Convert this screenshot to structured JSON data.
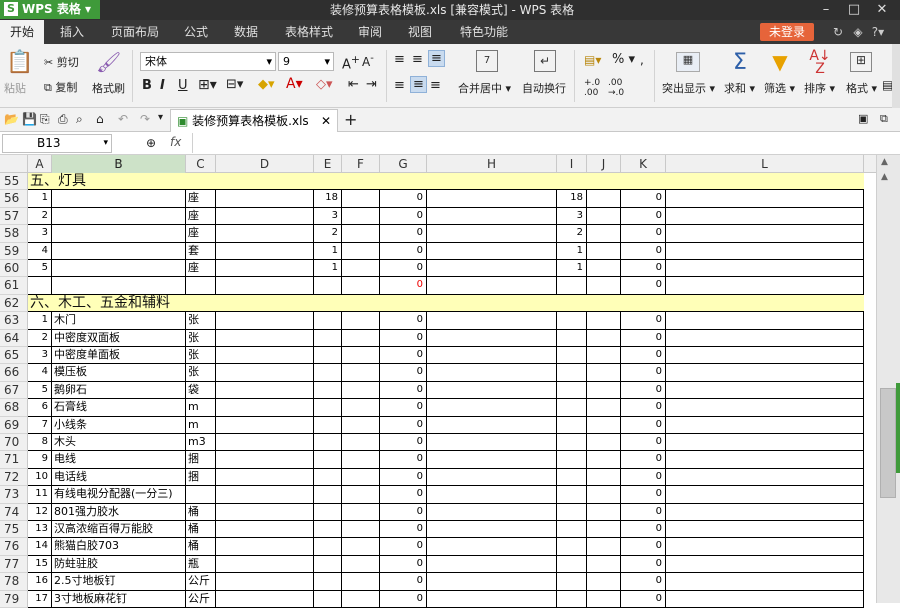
{
  "app": {
    "name": "WPS 表格",
    "window_title": "装修预算表格模板.xls [兼容模式] - WPS 表格"
  },
  "menus": [
    "开始",
    "插入",
    "页面布局",
    "公式",
    "数据",
    "表格样式",
    "审阅",
    "视图",
    "特色功能"
  ],
  "login": "未登录",
  "ribbon": {
    "paste": "粘贴",
    "cut": "剪切",
    "copy": "复制",
    "format_painter": "格式刷",
    "font_name": "宋体",
    "font_size": "9",
    "merge_center": "合并居中",
    "wrap_text": "自动换行",
    "percent": "%",
    "highlight": "突出显示",
    "sum": "求和",
    "filter": "筛选",
    "sort": "排序",
    "format": "格式"
  },
  "doc_tab": "装修预算表格模板.xls",
  "formula_bar": {
    "cell_ref": "B13",
    "fx": "fx",
    "value": ""
  },
  "columns": [
    "A",
    "B",
    "C",
    "D",
    "E",
    "F",
    "G",
    "H",
    "I",
    "J",
    "K",
    "L"
  ],
  "selected_column": "B",
  "rows": [
    {
      "n": "55",
      "type": "section",
      "title": "五、灯具"
    },
    {
      "n": "56",
      "a": "1",
      "b": "",
      "c": "座",
      "e": "18",
      "g": "0",
      "i": "18",
      "k": "0"
    },
    {
      "n": "57",
      "a": "2",
      "b": "",
      "c": "座",
      "e": "3",
      "g": "0",
      "i": "3",
      "k": "0"
    },
    {
      "n": "58",
      "a": "3",
      "b": "",
      "c": "座",
      "e": "2",
      "g": "0",
      "i": "2",
      "k": "0"
    },
    {
      "n": "59",
      "a": "4",
      "b": "",
      "c": "套",
      "e": "1",
      "g": "0",
      "i": "1",
      "k": "0"
    },
    {
      "n": "60",
      "a": "5",
      "b": "",
      "c": "座",
      "e": "1",
      "g": "0",
      "i": "1",
      "k": "0"
    },
    {
      "n": "61",
      "a": "",
      "b": "",
      "c": "",
      "e": "",
      "g": "0",
      "g_red": true,
      "i": "",
      "k": "0"
    },
    {
      "n": "62",
      "type": "section",
      "title": "六、木工、五金和辅料"
    },
    {
      "n": "63",
      "a": "1",
      "b": "木门",
      "c": "张",
      "e": "",
      "g": "0",
      "i": "",
      "k": "0"
    },
    {
      "n": "64",
      "a": "2",
      "b": "中密度双面板",
      "c": "张",
      "e": "",
      "g": "0",
      "i": "",
      "k": "0"
    },
    {
      "n": "65",
      "a": "3",
      "b": "中密度单面板",
      "c": "张",
      "e": "",
      "g": "0",
      "i": "",
      "k": "0"
    },
    {
      "n": "66",
      "a": "4",
      "b": "模压板",
      "c": "张",
      "e": "",
      "g": "0",
      "i": "",
      "k": "0"
    },
    {
      "n": "67",
      "a": "5",
      "b": "鹅卵石",
      "c": "袋",
      "e": "",
      "g": "0",
      "i": "",
      "k": "0"
    },
    {
      "n": "68",
      "a": "6",
      "b": "石膏线",
      "c": "m",
      "e": "",
      "g": "0",
      "i": "",
      "k": "0"
    },
    {
      "n": "69",
      "a": "7",
      "b": "小线条",
      "c": "m",
      "e": "",
      "g": "0",
      "i": "",
      "k": "0"
    },
    {
      "n": "70",
      "a": "8",
      "b": "木头",
      "c": "m3",
      "e": "",
      "g": "0",
      "i": "",
      "k": "0"
    },
    {
      "n": "71",
      "a": "9",
      "b": "电线",
      "c": "捆",
      "e": "",
      "g": "0",
      "i": "",
      "k": "0"
    },
    {
      "n": "72",
      "a": "10",
      "b": "电话线",
      "c": "捆",
      "e": "",
      "g": "0",
      "i": "",
      "k": "0"
    },
    {
      "n": "73",
      "a": "11",
      "b": "有线电视分配器(一分三)",
      "c": "",
      "e": "",
      "g": "0",
      "i": "",
      "k": "0"
    },
    {
      "n": "74",
      "a": "12",
      "b": "801强力胶水",
      "c": "桶",
      "e": "",
      "g": "0",
      "i": "",
      "k": "0"
    },
    {
      "n": "75",
      "a": "13",
      "b": "汉高浓缩百得万能胶",
      "c": "桶",
      "e": "",
      "g": "0",
      "i": "",
      "k": "0"
    },
    {
      "n": "76",
      "a": "14",
      "b": "熊猫白胶703",
      "c": "桶",
      "e": "",
      "g": "0",
      "i": "",
      "k": "0"
    },
    {
      "n": "77",
      "a": "15",
      "b": "防蛀驻胶",
      "c": "瓶",
      "e": "",
      "g": "0",
      "i": "",
      "k": "0"
    },
    {
      "n": "78",
      "a": "16",
      "b": "2.5寸地板钉",
      "c": "公斤",
      "e": "",
      "g": "0",
      "i": "",
      "k": "0"
    },
    {
      "n": "79",
      "a": "17",
      "b": "3寸地板麻花钉",
      "c": "公斤",
      "e": "",
      "g": "0",
      "i": "",
      "k": "0"
    }
  ]
}
